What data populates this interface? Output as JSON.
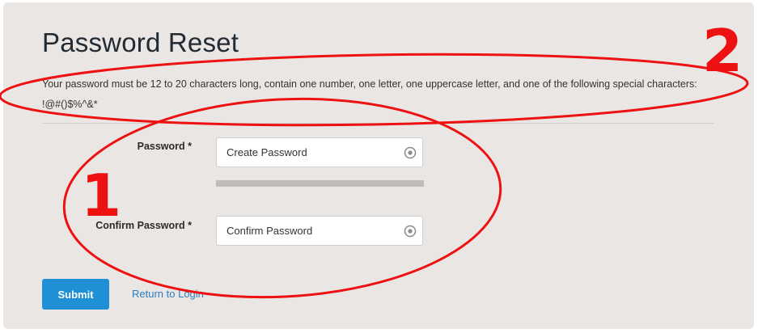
{
  "page": {
    "title": "Password Reset",
    "requirements": "Your password must be 12 to 20 characters long, contain one number, one letter, one uppercase letter, and one of the following special characters: !@#()$%^&*"
  },
  "form": {
    "password": {
      "label": "Password *",
      "placeholder": "Create Password",
      "icon": "eye-icon"
    },
    "strength_meter": {
      "level": 0
    },
    "confirm": {
      "label": "Confirm Password *",
      "placeholder": "Confirm Password",
      "icon": "eye-icon"
    },
    "submit_label": "Submit",
    "return_link_label": "Return to Login"
  },
  "annotations": {
    "color": "#ee1111",
    "marker_1": "1",
    "marker_2": "2"
  }
}
